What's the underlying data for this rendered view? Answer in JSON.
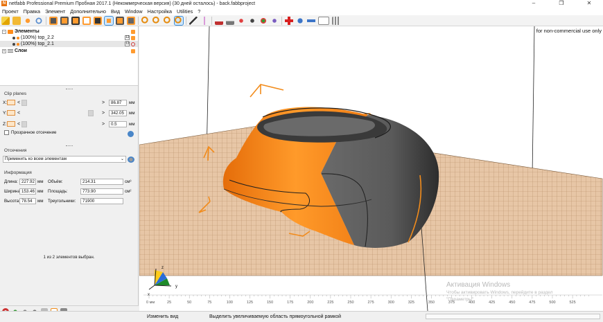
{
  "window": {
    "title": "netfabb Professional Premium Пробная 2017.1 (Некоммерческая версия) (30 дней осталось) - back.fabbproject",
    "logo_letter": "N",
    "minimize": "–",
    "maximize": "❐",
    "close": "✕"
  },
  "menu": [
    "Проект",
    "Правка",
    "Элемент",
    "Дополнительно",
    "Вид",
    "Window",
    "Настройка",
    "Utilities",
    "?"
  ],
  "tree": {
    "elements_label": "Элементы",
    "items": [
      {
        "label": "(100%) top_2.2",
        "badge": "12"
      },
      {
        "label": "(100%) top_2.1",
        "badge": "12"
      }
    ],
    "layers_label": "Слои"
  },
  "clip": {
    "title": "Clip planes",
    "rows": [
      {
        "axis": "X:",
        "value": "86.87",
        "unit": "мм"
      },
      {
        "axis": "Y:",
        "value": "342.05",
        "unit": "мм"
      },
      {
        "axis": "Z:",
        "value": "0.5",
        "unit": "мм"
      }
    ],
    "lt": "<",
    "gt": ">",
    "transparent_label": "Прозрачное отсечение"
  },
  "cut": {
    "title": "Отсечения",
    "combo_value": "Применить ко всем элементам"
  },
  "info": {
    "title": "Информация",
    "length_label": "Длина:",
    "length_value": "227.92",
    "length_unit": "мм",
    "width_label": "Ширина:",
    "width_value": "153.46",
    "width_unit": "мм",
    "height_label": "Высота:",
    "height_value": "78.54",
    "height_unit": "мм",
    "volume_label": "Объём:",
    "volume_value": "214.31",
    "volume_unit": "см³",
    "area_label": "Площадь:",
    "area_value": "773.90",
    "area_unit": "см²",
    "triangles_label": "Треугольники:",
    "triangles_value": "71900"
  },
  "selection_status": "1 из 2 элементов выбран.",
  "viewport": {
    "noncommercial": "for non-commercial use only",
    "ruler_labels": [
      "0 мм",
      "25",
      "50",
      "75",
      "100",
      "125",
      "150",
      "175",
      "200",
      "225",
      "250",
      "275",
      "300",
      "325",
      "350",
      "375",
      "400",
      "425",
      "450",
      "475",
      "500",
      "525"
    ],
    "axes": {
      "x": "x",
      "y": "y",
      "z": "z"
    },
    "watermark_title": "Активация Windows",
    "watermark_line1": "Чтобы активировать Windows, перейдите в раздел",
    "watermark_line2": "\"Параметры\"."
  },
  "statusbar": {
    "left": "Изменить вид",
    "mid": "Выделить увеличиваемую область прямоугольной рамкой"
  },
  "colors": {
    "orange": "#ff8a12",
    "gray": "#5f5f5f",
    "plate": "#e7c6a6",
    "grid": "#b78d67"
  }
}
